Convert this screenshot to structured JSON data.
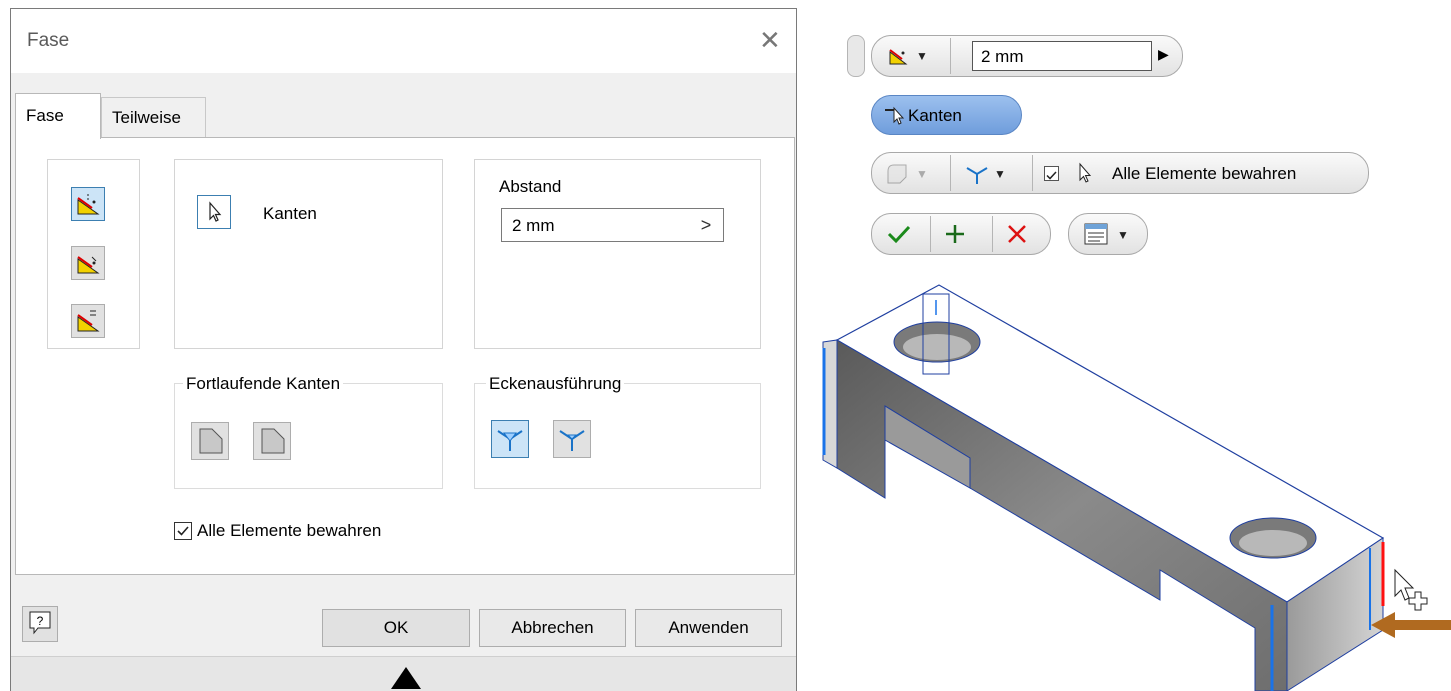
{
  "dialog": {
    "title": "Fase",
    "tabs": [
      {
        "label": "Fase",
        "active": true
      },
      {
        "label": "Teilweise",
        "active": false
      }
    ],
    "edges_label": "Kanten",
    "distance": {
      "label": "Abstand",
      "value": "2 mm"
    },
    "continuous_edges_label": "Fortlaufende Kanten",
    "corner_label": "Eckenausführung",
    "preserve_all": {
      "label": "Alle Elemente bewahren",
      "checked": true
    },
    "buttons": {
      "ok": "OK",
      "cancel": "Abbrechen",
      "apply": "Anwenden"
    }
  },
  "minitoolbar": {
    "distance_value": "2 mm",
    "edges_button": "Kanten",
    "preserve_all_label": "Alle Elemente bewahren",
    "accent": "#7aa6e0"
  },
  "icons": [
    "chamfer-distance-icon",
    "chamfer-distance-angle-icon",
    "chamfer-two-distances-icon",
    "select-cursor-icon",
    "chevron-right-icon",
    "continuous-edge-icon",
    "corner-setback-icon",
    "help-icon",
    "close-icon",
    "ok-check-icon",
    "plus-icon",
    "cancel-x-icon",
    "options-icon"
  ]
}
